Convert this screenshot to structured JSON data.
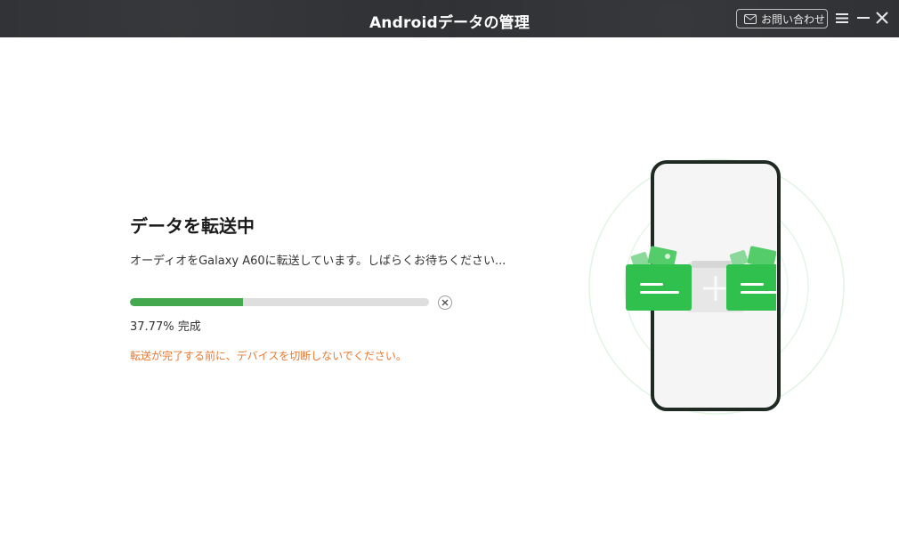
{
  "window": {
    "title": "Androidデータの管理",
    "contact_label": "お問い合わせ",
    "icons": [
      "mail-icon",
      "menu-icon",
      "minimize-icon",
      "close-icon"
    ]
  },
  "transfer": {
    "heading": "データを転送中",
    "status": "オーディオをGalaxy A60に転送しています。しばらくお待ちください...",
    "progress_fraction": 0.3777,
    "percent_text": "37.77%",
    "complete_label": "完成",
    "warning": "転送が完了する前に、デバイスを切断しないでください。"
  },
  "colors": {
    "titlebar": "#2f3033",
    "progress": "#44a84e",
    "warning": "#e9782e",
    "phone_frame": "#1f2a22",
    "folder_green": "#2fc04d"
  }
}
